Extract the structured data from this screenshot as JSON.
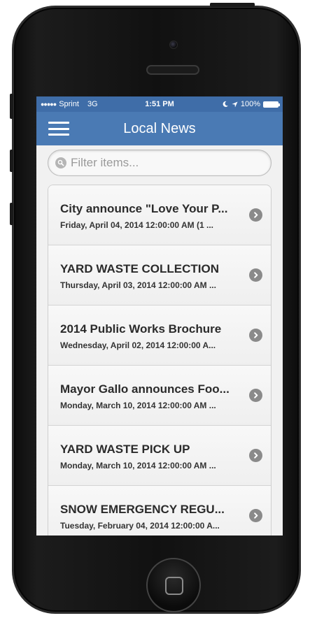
{
  "status": {
    "carrier": "Sprint",
    "network": "3G",
    "time": "1:51 PM",
    "battery_percent": "100%",
    "signal_dots": "●●●●●"
  },
  "header": {
    "title": "Local News",
    "menu_icon": "hamburger-icon"
  },
  "filter": {
    "placeholder": "Filter items..."
  },
  "items": [
    {
      "title": "City announce \"Love Your P...",
      "date": "Friday, April 04, 2014 12:00:00 AM  (1 ..."
    },
    {
      "title": "YARD WASTE COLLECTION",
      "date": "Thursday, April 03, 2014 12:00:00 AM  ..."
    },
    {
      "title": "2014 Public Works Brochure",
      "date": "Wednesday, April 02, 2014 12:00:00 A..."
    },
    {
      "title": "Mayor Gallo announces Foo...",
      "date": "Monday, March 10, 2014 12:00:00 AM  ..."
    },
    {
      "title": "YARD WASTE PICK UP",
      "date": "Monday, March 10, 2014 12:00:00 AM  ..."
    },
    {
      "title": "SNOW EMERGENCY REGU...",
      "date": "Tuesday, February 04, 2014 12:00:00 A..."
    }
  ],
  "colors": {
    "statusbar": "#3f6da8",
    "navbar": "#4a7ab4",
    "chevron": "#8a8a8a"
  }
}
